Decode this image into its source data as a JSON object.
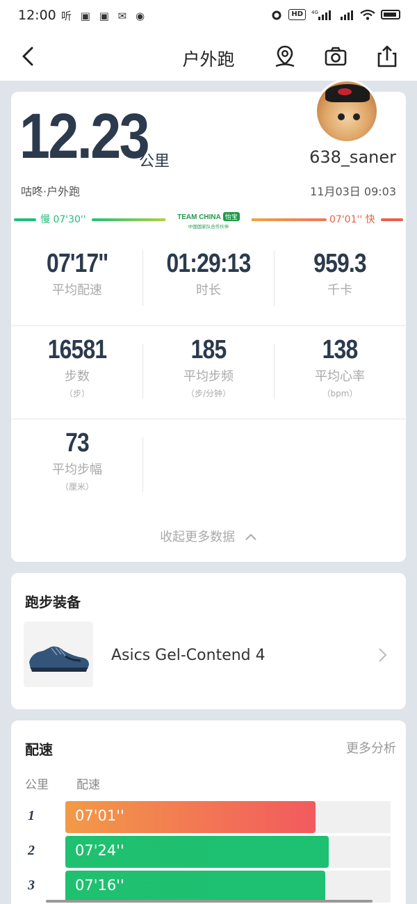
{
  "status_bar": {
    "time": "12:00",
    "left_glyphs": "听 ▣ ▣ ✉ ◉",
    "hd": "HD",
    "net": "4G"
  },
  "nav": {
    "title": "户外跑",
    "icons": [
      "back-arrow-icon",
      "location-pin-icon",
      "camera-icon",
      "share-icon"
    ]
  },
  "summary": {
    "distance": "12.23",
    "unit": "公里",
    "username": "638_saner",
    "source": "咕咚·户外跑",
    "datetime": "11月03日 09:03"
  },
  "pace_scale": {
    "slow": "慢 07'30''",
    "fast": "07'01'' 快",
    "logo_main": "TEAM CHINA",
    "logo_badge": "怡宝",
    "logo_sub": "中国国家队合作伙伴"
  },
  "metrics": [
    {
      "value": "07'17''",
      "label": "平均配速",
      "unit": ""
    },
    {
      "value": "01:29:13",
      "label": "时长",
      "unit": ""
    },
    {
      "value": "959.3",
      "label": "千卡",
      "unit": ""
    },
    {
      "value": "16581",
      "label": "步数",
      "unit": "（步）"
    },
    {
      "value": "185",
      "label": "平均步频",
      "unit": "（步/分钟）"
    },
    {
      "value": "138",
      "label": "平均心率",
      "unit": "（bpm）"
    },
    {
      "value": "73",
      "label": "平均步幅",
      "unit": "（厘米）"
    }
  ],
  "collapse_label": "收起更多数据",
  "gear": {
    "title": "跑步装备",
    "shoe_name": "Asics Gel-Contend 4"
  },
  "pace_section": {
    "title": "配速",
    "more": "更多分析",
    "col_km": "公里",
    "col_pace": "配速",
    "splits": [
      {
        "km": "1",
        "pace": "07'01''",
        "fill": 0.77,
        "colors": [
          "#f29a48",
          "#f25a5e"
        ]
      },
      {
        "km": "2",
        "pace": "07'24''",
        "fill": 0.81,
        "colors": [
          "#1fc06f",
          "#1ec072"
        ]
      },
      {
        "km": "3",
        "pace": "07'16''",
        "fill": 0.8,
        "colors": [
          "#1fc06f",
          "#1ec072"
        ]
      }
    ]
  }
}
